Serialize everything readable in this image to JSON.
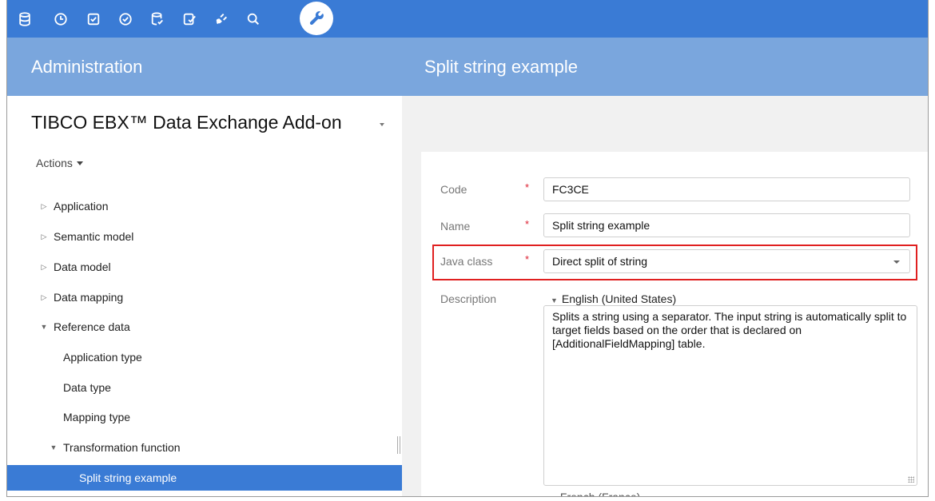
{
  "toolbar": {
    "icons": [
      "database-icon",
      "clock-icon",
      "checkbox-icon",
      "check-circle-icon",
      "data-validation-icon",
      "task-check-icon",
      "plug-icon",
      "search-icon",
      "wrench-icon"
    ],
    "active_icon": "wrench-icon",
    "color": "#3a7bd5"
  },
  "header": {
    "left_title": "Administration",
    "right_title": "Split string example"
  },
  "left_panel": {
    "dataspace_title": "TIBCO EBX™ Data Exchange Add-on",
    "actions_label": "Actions",
    "tree": [
      {
        "label": "Application",
        "state": "collapsed"
      },
      {
        "label": "Semantic model",
        "state": "collapsed"
      },
      {
        "label": "Data model",
        "state": "collapsed"
      },
      {
        "label": "Data mapping",
        "state": "collapsed"
      },
      {
        "label": "Reference data",
        "state": "expanded"
      },
      {
        "label": "Application type",
        "state": "leaf"
      },
      {
        "label": "Data type",
        "state": "leaf"
      },
      {
        "label": "Mapping type",
        "state": "leaf"
      },
      {
        "label": "Transformation function",
        "state": "expanded"
      },
      {
        "label": "Split string example",
        "state": "selected"
      }
    ],
    "selected_color": "#3a7bd5"
  },
  "form": {
    "code_label": "Code",
    "code_value": "FC3CE",
    "name_label": "Name",
    "name_value": "Split string example",
    "java_class_label": "Java class",
    "java_class_value": "Direct split of string",
    "description_label": "Description",
    "language_1": "English (United States)",
    "description_text": "Splits a string using a separator. The input string is automatically split to target fields based on the order that is declared on [AdditionalFieldMapping] table.",
    "language_2": "French (France)",
    "required_marker": "*",
    "highlight_color": "#e02020"
  }
}
